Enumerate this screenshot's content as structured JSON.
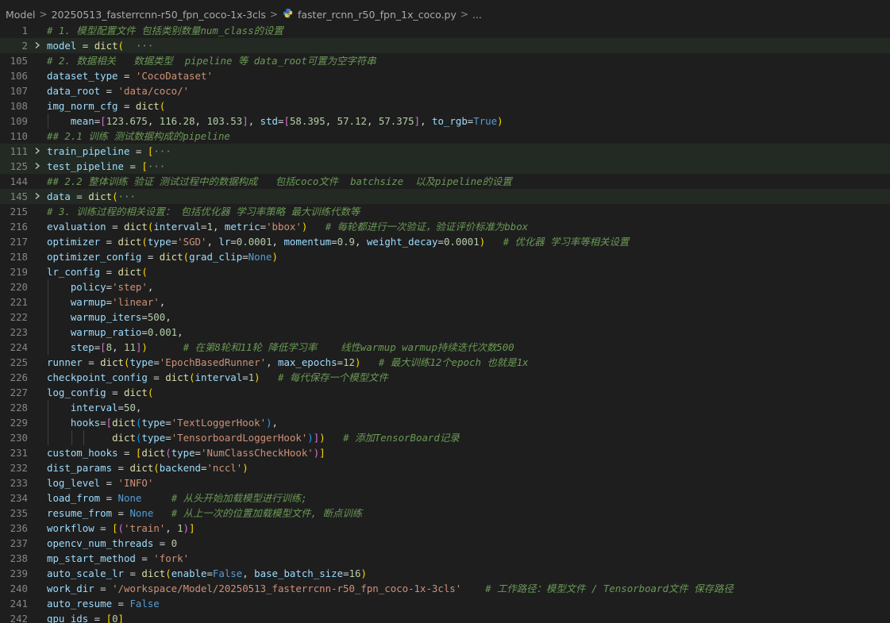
{
  "breadcrumb": {
    "segments": [
      "Model",
      "20250513_fasterrcnn-r50_fpn_coco-1x-3cls",
      "faster_rcnn_r50_fpn_1x_coco.py",
      "..."
    ],
    "file_icon": "python-file-icon"
  },
  "lines": [
    {
      "n": "1",
      "t": [
        [
          "cm",
          "# 1. 模型配置文件 包括类别数量num_class的设置"
        ]
      ]
    },
    {
      "n": "2",
      "fold": true,
      "t": [
        [
          "var",
          "model"
        ],
        [
          "op",
          " = "
        ],
        [
          "fn",
          "dict"
        ],
        [
          "b1",
          "("
        ],
        [
          "op",
          "  "
        ],
        [
          "ell",
          "···"
        ]
      ]
    },
    {
      "n": "105",
      "t": [
        [
          "cm",
          "# 2. 数据相关   数据类型  pipeline 等 data_root可置为空字符串"
        ]
      ]
    },
    {
      "n": "106",
      "t": [
        [
          "var",
          "dataset_type"
        ],
        [
          "op",
          " = "
        ],
        [
          "str",
          "'CocoDataset'"
        ]
      ]
    },
    {
      "n": "107",
      "t": [
        [
          "var",
          "data_root"
        ],
        [
          "op",
          " = "
        ],
        [
          "str",
          "'data/coco/'"
        ]
      ]
    },
    {
      "n": "108",
      "t": [
        [
          "var",
          "img_norm_cfg"
        ],
        [
          "op",
          " = "
        ],
        [
          "fn",
          "dict"
        ],
        [
          "b1",
          "("
        ]
      ]
    },
    {
      "n": "109",
      "g": 1,
      "t": [
        [
          "op",
          "    "
        ],
        [
          "var",
          "mean"
        ],
        [
          "op",
          "="
        ],
        [
          "b2",
          "["
        ],
        [
          "num",
          "123.675"
        ],
        [
          "op",
          ", "
        ],
        [
          "num",
          "116.28"
        ],
        [
          "op",
          ", "
        ],
        [
          "num",
          "103.53"
        ],
        [
          "b2",
          "]"
        ],
        [
          "op",
          ", "
        ],
        [
          "var",
          "std"
        ],
        [
          "op",
          "="
        ],
        [
          "b2",
          "["
        ],
        [
          "num",
          "58.395"
        ],
        [
          "op",
          ", "
        ],
        [
          "num",
          "57.12"
        ],
        [
          "op",
          ", "
        ],
        [
          "num",
          "57.375"
        ],
        [
          "b2",
          "]"
        ],
        [
          "op",
          ", "
        ],
        [
          "var",
          "to_rgb"
        ],
        [
          "op",
          "="
        ],
        [
          "kw",
          "True"
        ],
        [
          "b1",
          ")"
        ]
      ]
    },
    {
      "n": "110",
      "t": [
        [
          "cm",
          "## 2.1 训练 测试数据构成的pipeline"
        ]
      ]
    },
    {
      "n": "111",
      "fold": true,
      "t": [
        [
          "var",
          "train_pipeline"
        ],
        [
          "op",
          " = "
        ],
        [
          "b1",
          "["
        ],
        [
          "ell",
          "···"
        ]
      ]
    },
    {
      "n": "125",
      "fold": true,
      "t": [
        [
          "var",
          "test_pipeline"
        ],
        [
          "op",
          " = "
        ],
        [
          "b1",
          "["
        ],
        [
          "ell",
          "···"
        ]
      ]
    },
    {
      "n": "144",
      "t": [
        [
          "cm",
          "## 2.2 整体训练 验证 测试过程中的数据构成   包括coco文件  batchsize  以及pipeline的设置"
        ]
      ]
    },
    {
      "n": "145",
      "fold": true,
      "t": [
        [
          "var",
          "data"
        ],
        [
          "op",
          " = "
        ],
        [
          "fn",
          "dict"
        ],
        [
          "b1",
          "("
        ],
        [
          "ell",
          "···"
        ]
      ]
    },
    {
      "n": "215",
      "t": [
        [
          "cm",
          "# 3. 训练过程的相关设置： 包括优化器 学习率策略 最大训练代数等"
        ]
      ]
    },
    {
      "n": "216",
      "t": [
        [
          "var",
          "evaluation"
        ],
        [
          "op",
          " = "
        ],
        [
          "fn",
          "dict"
        ],
        [
          "b1",
          "("
        ],
        [
          "var",
          "interval"
        ],
        [
          "op",
          "="
        ],
        [
          "num",
          "1"
        ],
        [
          "op",
          ", "
        ],
        [
          "var",
          "metric"
        ],
        [
          "op",
          "="
        ],
        [
          "str",
          "'bbox'"
        ],
        [
          "b1",
          ")"
        ],
        [
          "op",
          "   "
        ],
        [
          "cm",
          "# 每轮都进行一次验证，验证评价标准为bbox"
        ]
      ]
    },
    {
      "n": "217",
      "t": [
        [
          "var",
          "optimizer"
        ],
        [
          "op",
          " = "
        ],
        [
          "fn",
          "dict"
        ],
        [
          "b1",
          "("
        ],
        [
          "var",
          "type"
        ],
        [
          "op",
          "="
        ],
        [
          "str",
          "'SGD'"
        ],
        [
          "op",
          ", "
        ],
        [
          "var",
          "lr"
        ],
        [
          "op",
          "="
        ],
        [
          "num",
          "0.0001"
        ],
        [
          "op",
          ", "
        ],
        [
          "var",
          "momentum"
        ],
        [
          "op",
          "="
        ],
        [
          "num",
          "0.9"
        ],
        [
          "op",
          ", "
        ],
        [
          "var",
          "weight_decay"
        ],
        [
          "op",
          "="
        ],
        [
          "num",
          "0.0001"
        ],
        [
          "b1",
          ")"
        ],
        [
          "op",
          "   "
        ],
        [
          "cm",
          "# 优化器 学习率等相关设置"
        ]
      ]
    },
    {
      "n": "218",
      "t": [
        [
          "var",
          "optimizer_config"
        ],
        [
          "op",
          " = "
        ],
        [
          "fn",
          "dict"
        ],
        [
          "b1",
          "("
        ],
        [
          "var",
          "grad_clip"
        ],
        [
          "op",
          "="
        ],
        [
          "kw",
          "None"
        ],
        [
          "b1",
          ")"
        ]
      ]
    },
    {
      "n": "219",
      "t": [
        [
          "var",
          "lr_config"
        ],
        [
          "op",
          " = "
        ],
        [
          "fn",
          "dict"
        ],
        [
          "b1",
          "("
        ]
      ]
    },
    {
      "n": "220",
      "g": 1,
      "t": [
        [
          "op",
          "    "
        ],
        [
          "var",
          "policy"
        ],
        [
          "op",
          "="
        ],
        [
          "str",
          "'step'"
        ],
        [
          "op",
          ","
        ]
      ]
    },
    {
      "n": "221",
      "g": 1,
      "t": [
        [
          "op",
          "    "
        ],
        [
          "var",
          "warmup"
        ],
        [
          "op",
          "="
        ],
        [
          "str",
          "'linear'"
        ],
        [
          "op",
          ","
        ]
      ]
    },
    {
      "n": "222",
      "g": 1,
      "t": [
        [
          "op",
          "    "
        ],
        [
          "var",
          "warmup_iters"
        ],
        [
          "op",
          "="
        ],
        [
          "num",
          "500"
        ],
        [
          "op",
          ","
        ]
      ]
    },
    {
      "n": "223",
      "g": 1,
      "t": [
        [
          "op",
          "    "
        ],
        [
          "var",
          "warmup_ratio"
        ],
        [
          "op",
          "="
        ],
        [
          "num",
          "0.001"
        ],
        [
          "op",
          ","
        ]
      ]
    },
    {
      "n": "224",
      "g": 1,
      "t": [
        [
          "op",
          "    "
        ],
        [
          "var",
          "step"
        ],
        [
          "op",
          "="
        ],
        [
          "b2",
          "["
        ],
        [
          "num",
          "8"
        ],
        [
          "op",
          ", "
        ],
        [
          "num",
          "11"
        ],
        [
          "b2",
          "]"
        ],
        [
          "b1",
          ")"
        ],
        [
          "op",
          "      "
        ],
        [
          "cm",
          "# 在第8轮和11轮 降低学习率    线性warmup warmup持续迭代次数500"
        ]
      ]
    },
    {
      "n": "225",
      "t": [
        [
          "var",
          "runner"
        ],
        [
          "op",
          " = "
        ],
        [
          "fn",
          "dict"
        ],
        [
          "b1",
          "("
        ],
        [
          "var",
          "type"
        ],
        [
          "op",
          "="
        ],
        [
          "str",
          "'EpochBasedRunner'"
        ],
        [
          "op",
          ", "
        ],
        [
          "var",
          "max_epochs"
        ],
        [
          "op",
          "="
        ],
        [
          "num",
          "12"
        ],
        [
          "b1",
          ")"
        ],
        [
          "op",
          "   "
        ],
        [
          "cm",
          "# 最大训练12个epoch 也就是1x"
        ]
      ]
    },
    {
      "n": "226",
      "t": [
        [
          "var",
          "checkpoint_config"
        ],
        [
          "op",
          " = "
        ],
        [
          "fn",
          "dict"
        ],
        [
          "b1",
          "("
        ],
        [
          "var",
          "interval"
        ],
        [
          "op",
          "="
        ],
        [
          "num",
          "1"
        ],
        [
          "b1",
          ")"
        ],
        [
          "op",
          "   "
        ],
        [
          "cm",
          "# 每代保存一个模型文件"
        ]
      ]
    },
    {
      "n": "227",
      "t": [
        [
          "var",
          "log_config"
        ],
        [
          "op",
          " = "
        ],
        [
          "fn",
          "dict"
        ],
        [
          "b1",
          "("
        ]
      ]
    },
    {
      "n": "228",
      "g": 1,
      "t": [
        [
          "op",
          "    "
        ],
        [
          "var",
          "interval"
        ],
        [
          "op",
          "="
        ],
        [
          "num",
          "50"
        ],
        [
          "op",
          ","
        ]
      ]
    },
    {
      "n": "229",
      "g": 1,
      "t": [
        [
          "op",
          "    "
        ],
        [
          "var",
          "hooks"
        ],
        [
          "op",
          "="
        ],
        [
          "b2",
          "["
        ],
        [
          "fn",
          "dict"
        ],
        [
          "b3",
          "("
        ],
        [
          "var",
          "type"
        ],
        [
          "op",
          "="
        ],
        [
          "str",
          "'TextLoggerHook'"
        ],
        [
          "b3",
          ")"
        ],
        [
          "op",
          ","
        ]
      ]
    },
    {
      "n": "230",
      "g": 3,
      "t": [
        [
          "op",
          "           "
        ],
        [
          "fn",
          "dict"
        ],
        [
          "b3",
          "("
        ],
        [
          "var",
          "type"
        ],
        [
          "op",
          "="
        ],
        [
          "str",
          "'TensorboardLoggerHook'"
        ],
        [
          "b3",
          ")"
        ],
        [
          "b2",
          "]"
        ],
        [
          "b1",
          ")"
        ],
        [
          "op",
          "   "
        ],
        [
          "cm",
          "# 添加TensorBoard记录"
        ]
      ]
    },
    {
      "n": "231",
      "t": [
        [
          "var",
          "custom_hooks"
        ],
        [
          "op",
          " = "
        ],
        [
          "b1",
          "["
        ],
        [
          "fn",
          "dict"
        ],
        [
          "b2",
          "("
        ],
        [
          "var",
          "type"
        ],
        [
          "op",
          "="
        ],
        [
          "str",
          "'NumClassCheckHook'"
        ],
        [
          "b2",
          ")"
        ],
        [
          "b1",
          "]"
        ]
      ]
    },
    {
      "n": "232",
      "t": [
        [
          "var",
          "dist_params"
        ],
        [
          "op",
          " = "
        ],
        [
          "fn",
          "dict"
        ],
        [
          "b1",
          "("
        ],
        [
          "var",
          "backend"
        ],
        [
          "op",
          "="
        ],
        [
          "str",
          "'nccl'"
        ],
        [
          "b1",
          ")"
        ]
      ]
    },
    {
      "n": "233",
      "t": [
        [
          "var",
          "log_level"
        ],
        [
          "op",
          " = "
        ],
        [
          "str",
          "'INFO'"
        ]
      ]
    },
    {
      "n": "234",
      "t": [
        [
          "var",
          "load_from"
        ],
        [
          "op",
          " = "
        ],
        [
          "kw",
          "None"
        ],
        [
          "op",
          "     "
        ],
        [
          "cm",
          "# 从头开始加载模型进行训练;"
        ]
      ]
    },
    {
      "n": "235",
      "t": [
        [
          "var",
          "resume_from"
        ],
        [
          "op",
          " = "
        ],
        [
          "kw",
          "None"
        ],
        [
          "op",
          "   "
        ],
        [
          "cm",
          "# 从上一次的位置加载模型文件, 断点训练"
        ]
      ]
    },
    {
      "n": "236",
      "t": [
        [
          "var",
          "workflow"
        ],
        [
          "op",
          " = "
        ],
        [
          "b1",
          "["
        ],
        [
          "b2",
          "("
        ],
        [
          "str",
          "'train'"
        ],
        [
          "op",
          ", "
        ],
        [
          "num",
          "1"
        ],
        [
          "b2",
          ")"
        ],
        [
          "b1",
          "]"
        ]
      ]
    },
    {
      "n": "237",
      "t": [
        [
          "var",
          "opencv_num_threads"
        ],
        [
          "op",
          " = "
        ],
        [
          "num",
          "0"
        ]
      ]
    },
    {
      "n": "238",
      "t": [
        [
          "var",
          "mp_start_method"
        ],
        [
          "op",
          " = "
        ],
        [
          "str",
          "'fork'"
        ]
      ]
    },
    {
      "n": "239",
      "t": [
        [
          "var",
          "auto_scale_lr"
        ],
        [
          "op",
          " = "
        ],
        [
          "fn",
          "dict"
        ],
        [
          "b1",
          "("
        ],
        [
          "var",
          "enable"
        ],
        [
          "op",
          "="
        ],
        [
          "kw",
          "False"
        ],
        [
          "op",
          ", "
        ],
        [
          "var",
          "base_batch_size"
        ],
        [
          "op",
          "="
        ],
        [
          "num",
          "16"
        ],
        [
          "b1",
          ")"
        ]
      ]
    },
    {
      "n": "240",
      "t": [
        [
          "var",
          "work_dir"
        ],
        [
          "op",
          " = "
        ],
        [
          "str",
          "'/workspace/Model/20250513_fasterrcnn-r50_fpn_coco-1x-3cls'"
        ],
        [
          "op",
          "    "
        ],
        [
          "cm",
          "# 工作路径：模型文件 / Tensorboard文件 保存路径"
        ]
      ]
    },
    {
      "n": "241",
      "t": [
        [
          "var",
          "auto_resume"
        ],
        [
          "op",
          " = "
        ],
        [
          "kw",
          "False"
        ]
      ]
    },
    {
      "n": "242",
      "t": [
        [
          "var",
          "gpu_ids"
        ],
        [
          "op",
          " = "
        ],
        [
          "b1",
          "["
        ],
        [
          "num",
          "0"
        ],
        [
          "b1",
          "]"
        ]
      ]
    }
  ]
}
